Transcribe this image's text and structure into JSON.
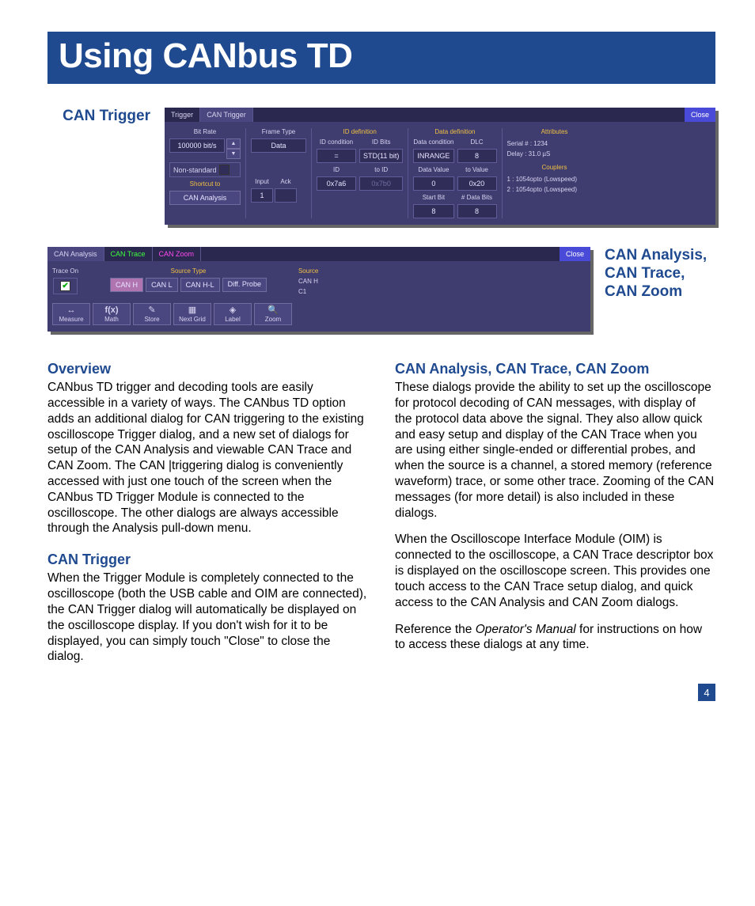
{
  "title": "Using CANbus TD",
  "sideLabel1": "CAN Trigger",
  "sideLabel2": "CAN Analysis, CAN Trace, CAN Zoom",
  "page": "4",
  "panel1": {
    "tabs": [
      "Trigger",
      "CAN Trigger"
    ],
    "close": "Close",
    "bitrate_lbl": "Bit Rate",
    "bitrate": "100000 bit/s",
    "nonstd": "Non-standard",
    "shortcut_lbl": "Shortcut to",
    "shortcut": "CAN Analysis",
    "frametype_lbl": "Frame Type",
    "frametype": "Data",
    "input_lbl": "Input",
    "input": "1",
    "ack_lbl": "Ack",
    "iddef": "ID definition",
    "idcond_lbl": "ID condition",
    "idcond": "=",
    "idbits_lbl": "ID Bits",
    "idbits": "STD(11 bit)",
    "id_lbl": "ID",
    "id": "0x7a6",
    "toid_lbl": "to ID",
    "toid": "0x7b0",
    "datadef": "Data definition",
    "datacond_lbl": "Data condition",
    "datacond": "INRANGE",
    "dlc_lbl": "DLC",
    "dlc": "8",
    "dataval_lbl": "Data Value",
    "dataval": "0",
    "tovalue_lbl": "to Value",
    "tovalue": "0x20",
    "startbit_lbl": "Start Bit",
    "startbit": "8",
    "databits_lbl": "# Data Bits",
    "databits": "8",
    "attributes": "Attributes",
    "serial": "Serial # :        1234",
    "delay": "Delay :        31.0 µS",
    "couplers": "Couplers",
    "c1": "1 : 1054opto (Lowspeed)",
    "c2": "2 : 1054opto (Lowspeed)"
  },
  "panel2": {
    "tabs": [
      "CAN Analysis",
      "CAN Trace",
      "CAN Zoom"
    ],
    "close": "Close",
    "traceon": "Trace On",
    "srctype_lbl": "Source Type",
    "src_lbl": "Source",
    "src1": "CAN H",
    "src2": "C1",
    "btns": [
      "CAN H",
      "CAN L",
      "CAN H-L",
      "Diff. Probe"
    ],
    "tools": [
      {
        "name": "Measure",
        "icon": "↔"
      },
      {
        "name": "Math",
        "icon": "f(x)"
      },
      {
        "name": "Store",
        "icon": "✎"
      },
      {
        "name": "Next Grid",
        "icon": "▦"
      },
      {
        "name": "Label",
        "icon": "◈"
      },
      {
        "name": "Zoom",
        "icon": "🔍"
      }
    ]
  },
  "text": {
    "h_overview": "Overview",
    "p_overview": "CANbus TD trigger and decoding tools are easily accessible in a variety of ways. The CANbus TD option adds an additional dialog for CAN triggering to the existing oscilloscope Trigger dialog, and a new set of dialogs for setup of the CAN Analysis and viewable CAN Trace and CAN Zoom. The CAN |triggering dialog is conveniently accessed with just one touch of the screen when the CANbus TD Trigger Module is connected to the oscilloscope. The other dialogs are always accessible through the Analysis pull-down menu.",
    "h_cantrig": "CAN Trigger",
    "p_cantrig": "When the Trigger Module is completely connected to the oscilloscope (both the USB cable and OIM are connected), the CAN Trigger dialog will automatically be displayed on the oscilloscope display. If you don't wish for it to be displayed, you can simply touch \"Close\" to close the dialog.",
    "h_analysis": "CAN Analysis, CAN Trace, CAN Zoom",
    "p_analysis1": "These dialogs provide the ability to set up the oscilloscope for protocol decoding of CAN messages, with display of the protocol data above the signal. They also allow quick and easy setup and display of the CAN Trace when you are using either single-ended or differential probes, and when the source is a channel, a stored memory (reference waveform) trace, or some other trace. Zooming of the CAN messages (for more detail) is also included in these dialogs.",
    "p_analysis2": "When the Oscilloscope Interface Module (OIM) is connected to the oscilloscope, a CAN Trace descriptor box is displayed on the oscilloscope screen. This provides one touch access to the CAN Trace setup dialog, and quick access to the CAN Analysis and CAN Zoom dialogs.",
    "p_analysis3a": "Reference the ",
    "p_analysis3b": "Operator's Manual",
    "p_analysis3c": " for instructions on how to access these dialogs at any time."
  }
}
